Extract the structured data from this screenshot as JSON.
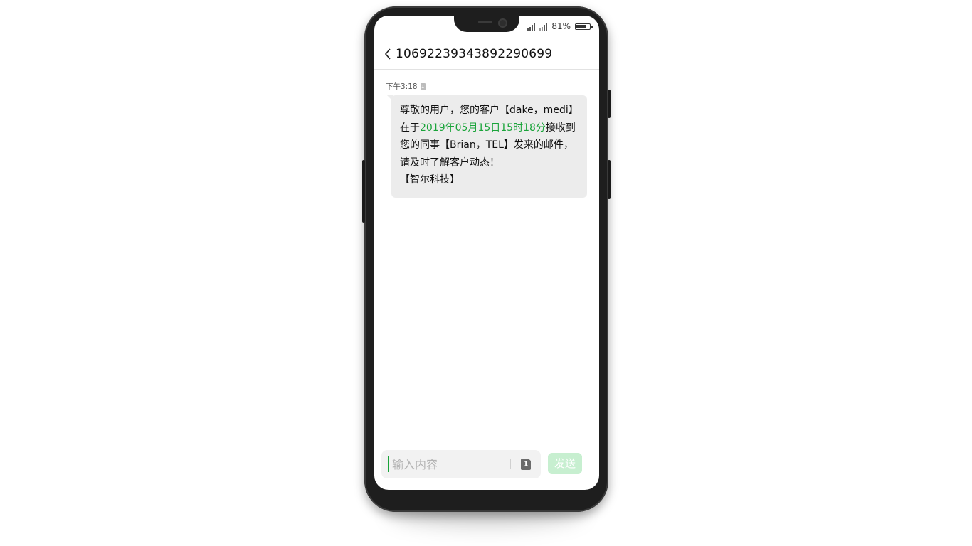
{
  "status_bar": {
    "battery_text": "81%",
    "battery_level": 0.81
  },
  "header": {
    "back_icon": "chevron-left-icon",
    "title": "10692239343892290699"
  },
  "message": {
    "time": "下午3:18",
    "sim_badge": "1",
    "lines": [
      {
        "before": "尊敬的用户，您的客户【dake，medi】",
        "link": "",
        "after": ""
      },
      {
        "before": "在于",
        "link": "2019年05月15日15时18分",
        "after": "接收到"
      },
      {
        "before": "您的同事【Brian，TEL】发来的邮件，",
        "link": "",
        "after": ""
      },
      {
        "before": "请及时了解客户动态！",
        "link": "",
        "after": ""
      },
      {
        "before": "【智尔科技】",
        "link": "",
        "after": ""
      }
    ]
  },
  "composer": {
    "placeholder": "输入内容",
    "sim_slot": "1",
    "send_label": "发送"
  },
  "colors": {
    "link": "#1aa43a",
    "bubble": "#ececec",
    "send_disabled": "#c7efd0"
  }
}
